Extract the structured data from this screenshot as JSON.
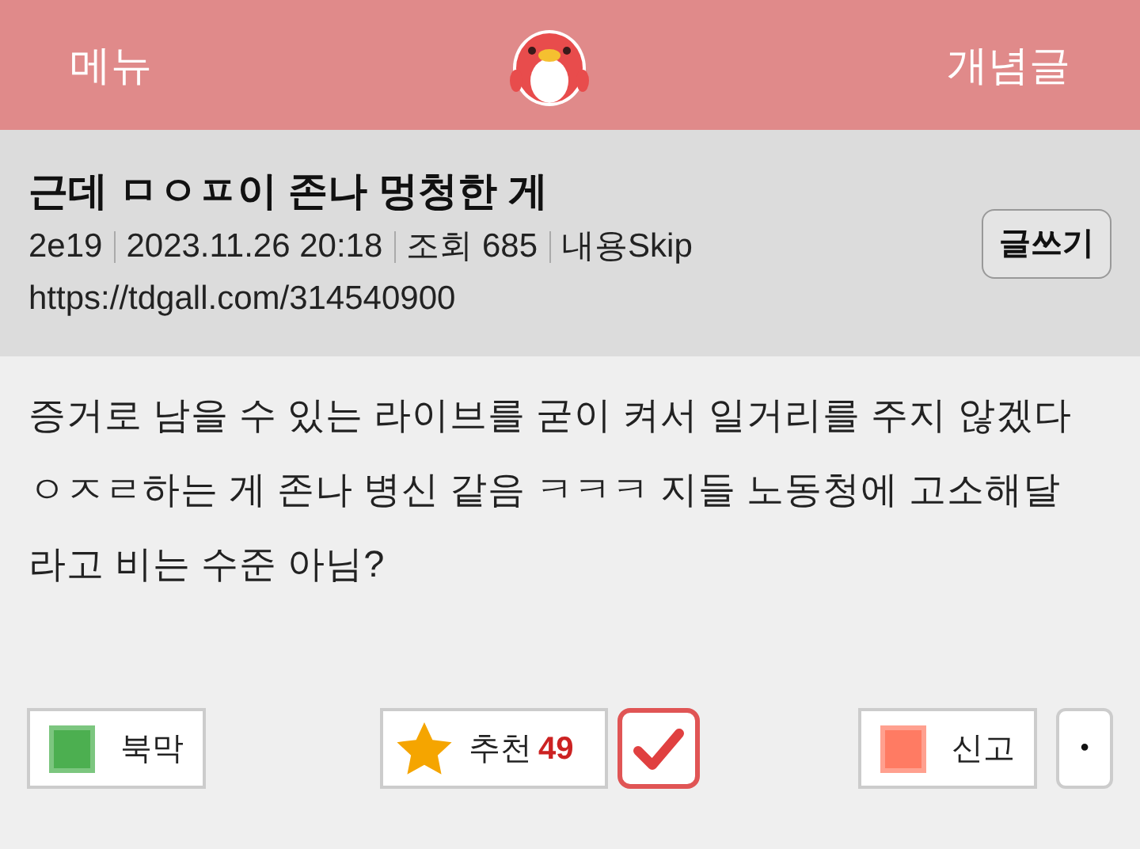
{
  "header": {
    "menu": "메뉴",
    "concept": "개념글"
  },
  "post": {
    "title": "근데 ㅁㅇㅍ이 존나 멍청한 게",
    "author": "2e19",
    "date": "2023.11.26 20:18",
    "views": "조회 685",
    "skip": "내용Skip",
    "url": "https://tdgall.com/314540900",
    "write_button": "글쓰기"
  },
  "body": "증거로 남을 수 있는 라이브를 굳이 켜서 일거리를 주지 않겠다 ㅇㅈㄹ하는 게 존나 병신 같음 ㅋㅋㅋ 지들 노동청에 고소해달라고 비는 수준 아님?",
  "actions": {
    "block": "북막",
    "recommend": "추천",
    "recommend_count": "49",
    "report": "신고",
    "more": "•"
  }
}
